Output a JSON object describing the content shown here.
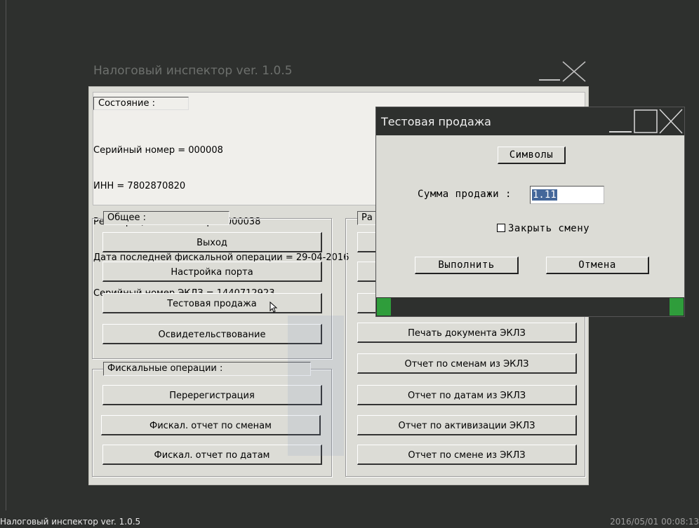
{
  "main_window": {
    "title": "Налоговый инспектор ver. 1.0.5",
    "state": {
      "legend": "Состояние :",
      "lines": [
        "Серийный номер = 000008",
        "ИНН = 7802870820",
        "Регистрационный номер = 000038",
        "Дата последней фискальной операции = 29-04-2016",
        "Серийный номер ЭКЛЗ = 1440712923"
      ]
    },
    "general": {
      "legend": "Общее :",
      "buttons": [
        "Выход",
        "Настройка порта",
        "Тестовая продажа",
        "Освидетельствование"
      ]
    },
    "fiscal": {
      "legend": "Фискальные операции :",
      "buttons": [
        "Перерегистрация",
        "Фискал. отчет по сменам",
        "Фискал. отчет по датам"
      ]
    },
    "eklz": {
      "legend_visible": "Ра",
      "buttons": [
        "Печать документа ЭКЛЗ",
        "Отчет по сменам из ЭКЛЗ",
        "Отчет по датам из ЭКЛЗ",
        "Отчет по активизации ЭКЛЗ",
        "Отчет по смене из ЭКЛЗ"
      ]
    }
  },
  "dialog": {
    "title": "Тестовая продажа",
    "symbols_button": "Символы",
    "sum_label": "Сумма продажи :",
    "sum_value": "1.11",
    "close_shift_label": "Закрыть смену",
    "close_shift_checked": false,
    "execute_button": "Выполнить",
    "cancel_button": "Отмена"
  },
  "taskbar": {
    "app_label": "Налоговый инспектор ver. 1.0.5",
    "clock": "2016/05/01 00:08:13"
  },
  "icons": {
    "minimize": "minimize-icon",
    "maximize": "maximize-icon",
    "close": "close-icon",
    "cursor": "mouse-cursor-icon"
  },
  "colors": {
    "desktop": "#2e302e",
    "window": "#dcdcd6",
    "progress_green": "#2f9d3b",
    "selection": "#44679a"
  }
}
